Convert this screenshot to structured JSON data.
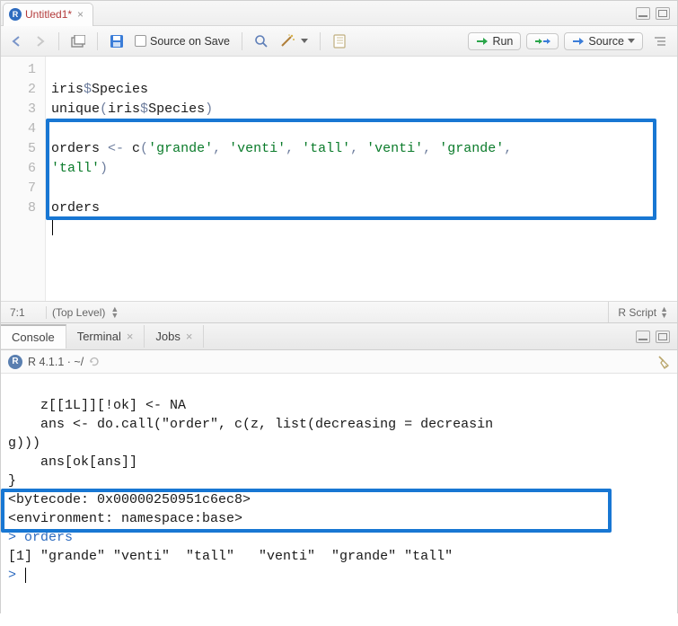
{
  "editor": {
    "tab": {
      "title": "Untitled1*"
    },
    "toolbar": {
      "source_on_save": "Source on Save",
      "run": "Run",
      "source": "Source"
    },
    "gutter": [
      "1",
      "2",
      "3",
      "4",
      "",
      "5",
      "6",
      "7",
      "8"
    ],
    "code": {
      "l1_a": "iris",
      "l1_b": "$",
      "l1_c": "Species",
      "l2_a": "unique",
      "l2_b": "(",
      "l2_c": "iris",
      "l2_d": "$",
      "l2_e": "Species",
      "l2_f": ")",
      "l4_a": "orders ",
      "l4_b": "<-",
      "l4_c": " c",
      "l4_d": "(",
      "l4_s1": "'grande'",
      "l4_s2": "'venti'",
      "l4_s3": "'tall'",
      "l4_s4": "'venti'",
      "l4_s5": "'grande'",
      "l4_comma": ", ",
      "l4_comma_end": ",",
      "l4w_s6": "'tall'",
      "l4w_b": ")",
      "l6_a": "orders"
    },
    "status": {
      "pos": "7:1",
      "scope": "(Top Level)",
      "lang": "R Script"
    }
  },
  "console": {
    "tabs": {
      "console": "Console",
      "terminal": "Terminal",
      "jobs": "Jobs"
    },
    "status": "R 4.1.1 · ~/",
    "lines": {
      "l1": "    z[[1L]][!ok] <- NA",
      "l2": "    ans <- do.call(\"order\", c(z, list(decreasing = decreasin",
      "l3": "g)))",
      "l4": "    ans[ok[ans]]",
      "l5": "}",
      "l6": "<bytecode: 0x00000250951c6ec8>",
      "l7": "<environment: namespace:base>",
      "p1": "> ",
      "in1": "orders",
      "out1": "[1] \"grande\" \"venti\"  \"tall\"   \"venti\"  \"grande\" \"tall\"  ",
      "p2": "> "
    }
  }
}
